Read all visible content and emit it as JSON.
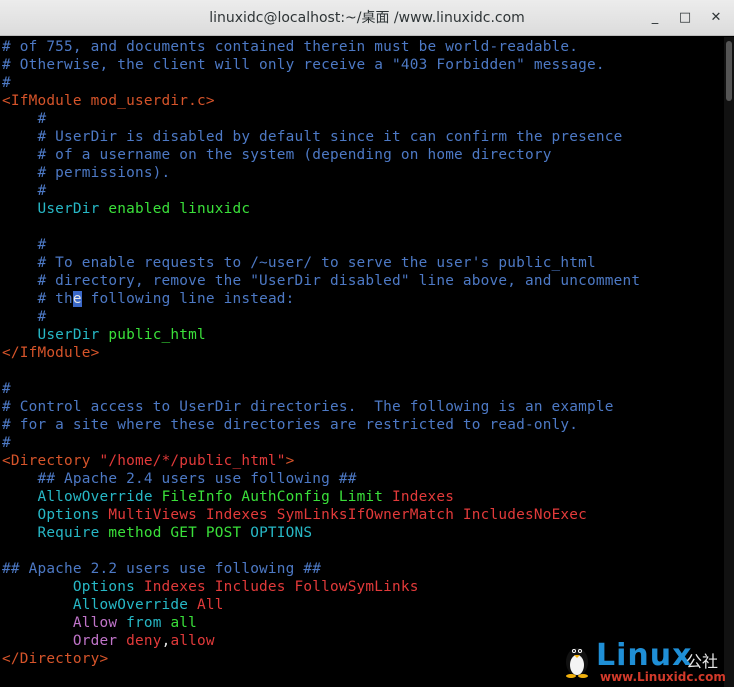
{
  "window": {
    "title": "linuxidc@localhost:~/桌面 /www.linuxidc.com"
  },
  "controls": {
    "minimize": "_",
    "maximize": "□",
    "close": "✕"
  },
  "lines": [
    {
      "segments": [
        {
          "cls": "c",
          "text": "# of 755, and documents contained therein must be world-readable."
        }
      ]
    },
    {
      "segments": [
        {
          "cls": "c",
          "text": "# Otherwise, the client will only receive a \"403 Forbidden\" message."
        }
      ]
    },
    {
      "segments": [
        {
          "cls": "c",
          "text": "#"
        }
      ]
    },
    {
      "segments": [
        {
          "cls": "t",
          "text": "<IfModule mod_userdir.c>"
        }
      ]
    },
    {
      "segments": [
        {
          "cls": "c",
          "text": "    #"
        }
      ]
    },
    {
      "segments": [
        {
          "cls": "c",
          "text": "    # UserDir is disabled by default since it can confirm the presence"
        }
      ]
    },
    {
      "segments": [
        {
          "cls": "c",
          "text": "    # of a username on the system (depending on home directory"
        }
      ]
    },
    {
      "segments": [
        {
          "cls": "c",
          "text": "    # permissions)."
        }
      ]
    },
    {
      "segments": [
        {
          "cls": "c",
          "text": "    #"
        }
      ]
    },
    {
      "segments": [
        {
          "cls": "k",
          "text": "    UserDir "
        },
        {
          "cls": "g",
          "text": "enabled linuxidc"
        }
      ]
    },
    {
      "segments": [
        {
          "cls": "w",
          "text": ""
        }
      ]
    },
    {
      "segments": [
        {
          "cls": "c",
          "text": "    #"
        }
      ]
    },
    {
      "segments": [
        {
          "cls": "c",
          "text": "    # To enable requests to /~user/ to serve the user's public_html"
        }
      ]
    },
    {
      "segments": [
        {
          "cls": "c",
          "text": "    # directory, remove the \"UserDir disabled\" line above, and uncomment"
        }
      ]
    },
    {
      "segments": [
        {
          "cls": "c",
          "text": "    # th"
        },
        {
          "cls": "cursor",
          "text": "e"
        },
        {
          "cls": "c",
          "text": " following line instead:"
        }
      ]
    },
    {
      "segments": [
        {
          "cls": "c",
          "text": "    #"
        }
      ]
    },
    {
      "segments": [
        {
          "cls": "k",
          "text": "    UserDir "
        },
        {
          "cls": "g",
          "text": "public_html"
        }
      ]
    },
    {
      "segments": [
        {
          "cls": "t",
          "text": "</IfModule>"
        }
      ]
    },
    {
      "segments": [
        {
          "cls": "w",
          "text": ""
        }
      ]
    },
    {
      "segments": [
        {
          "cls": "c",
          "text": "#"
        }
      ]
    },
    {
      "segments": [
        {
          "cls": "c",
          "text": "# Control access to UserDir directories.  The following is an example"
        }
      ]
    },
    {
      "segments": [
        {
          "cls": "c",
          "text": "# for a site where these directories are restricted to read-only."
        }
      ]
    },
    {
      "segments": [
        {
          "cls": "c",
          "text": "#"
        }
      ]
    },
    {
      "segments": [
        {
          "cls": "t",
          "text": "<Directory "
        },
        {
          "cls": "r",
          "text": "\"/home/*/public_html\""
        },
        {
          "cls": "t",
          "text": ">"
        }
      ]
    },
    {
      "segments": [
        {
          "cls": "c",
          "text": "    ## Apache 2.4 users use following ##"
        }
      ]
    },
    {
      "segments": [
        {
          "cls": "k",
          "text": "    AllowOverride "
        },
        {
          "cls": "g",
          "text": "FileInfo AuthConfig Limit "
        },
        {
          "cls": "r",
          "text": "Indexes"
        }
      ]
    },
    {
      "segments": [
        {
          "cls": "k",
          "text": "    Options "
        },
        {
          "cls": "r",
          "text": "MultiViews Indexes SymLinksIfOwnerMatch IncludesNoExec"
        }
      ]
    },
    {
      "segments": [
        {
          "cls": "k",
          "text": "    Require "
        },
        {
          "cls": "g",
          "text": "method GET POST "
        },
        {
          "cls": "k",
          "text": "OPTIONS"
        }
      ]
    },
    {
      "segments": [
        {
          "cls": "w",
          "text": ""
        }
      ]
    },
    {
      "segments": [
        {
          "cls": "c",
          "text": "## Apache 2.2 users use following ##"
        }
      ]
    },
    {
      "segments": [
        {
          "cls": "k",
          "text": "        Options "
        },
        {
          "cls": "r",
          "text": "Indexes Includes FollowSymLinks"
        }
      ]
    },
    {
      "segments": [
        {
          "cls": "k",
          "text": "        AllowOverride "
        },
        {
          "cls": "r",
          "text": "All"
        }
      ]
    },
    {
      "segments": [
        {
          "cls": "p",
          "text": "        Allow "
        },
        {
          "cls": "k",
          "text": "from "
        },
        {
          "cls": "g",
          "text": "all"
        }
      ]
    },
    {
      "segments": [
        {
          "cls": "p",
          "text": "        Order "
        },
        {
          "cls": "r",
          "text": "deny"
        },
        {
          "cls": "w",
          "text": ","
        },
        {
          "cls": "r",
          "text": "allow"
        }
      ]
    },
    {
      "segments": [
        {
          "cls": "t",
          "text": "</Directory>"
        }
      ]
    }
  ],
  "watermark": {
    "brand": "Linux",
    "cn": "公社",
    "url": "www.Linuxidc.com"
  },
  "colors": {
    "comment": "#4d79c5",
    "tag": "#d6542a",
    "keyword": "#27b8c6",
    "value_green": "#3ae03a",
    "value_red": "#e23a3a",
    "purple": "#c074c9",
    "cursor": "#3a68c8"
  }
}
